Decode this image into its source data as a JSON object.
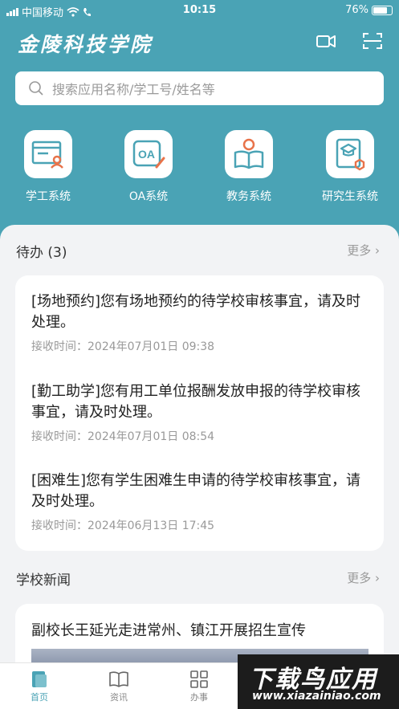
{
  "status_bar": {
    "carrier": "中国移动",
    "time": "10:15",
    "battery": "76%",
    "battery_level": 0.76
  },
  "header": {
    "brand": "金陵科技学院",
    "icons": [
      "video-camera-icon",
      "scan-icon"
    ]
  },
  "search": {
    "placeholder": "搜索应用名称/学工号/姓名等"
  },
  "systems": [
    {
      "label": "学工系统",
      "icon": "student-affairs-icon"
    },
    {
      "label": "OA系统",
      "icon": "oa-icon"
    },
    {
      "label": "教务系统",
      "icon": "academic-affairs-icon"
    },
    {
      "label": "研究生系统",
      "icon": "graduate-icon"
    }
  ],
  "todo": {
    "title": "待办 (3)",
    "more": "更多",
    "items": [
      {
        "text": "[场地预约]您有场地预约的待学校审核事宜，请及时处理。",
        "time": "接收时间：2024年07月01日 09:38"
      },
      {
        "text": "[勤工助学]您有用工单位报酬发放申报的待学校审核事宜，请及时处理。",
        "time": "接收时间：2024年07月01日 08:54"
      },
      {
        "text": "[困难生]您有学生困难生申请的待学校审核事宜，请及时处理。",
        "time": "接收时间：2024年06月13日 17:45"
      }
    ]
  },
  "news": {
    "title": "学校新闻",
    "more": "更多",
    "headline": "副校长王延光走进常州、镇江开展招生宣传"
  },
  "tabbar": {
    "tabs": [
      {
        "label": "首页",
        "icon": "home-icon",
        "active": true
      },
      {
        "label": "资讯",
        "icon": "book-icon",
        "active": false
      },
      {
        "label": "办事",
        "icon": "grid-icon",
        "active": false
      }
    ]
  },
  "watermark": {
    "line1": "下载鸟应用",
    "line2": "www.xiazainiao.com"
  },
  "colors": {
    "primary": "#4aa3b5",
    "accent_orange": "#e8734a",
    "background": "#f2f3f5"
  }
}
